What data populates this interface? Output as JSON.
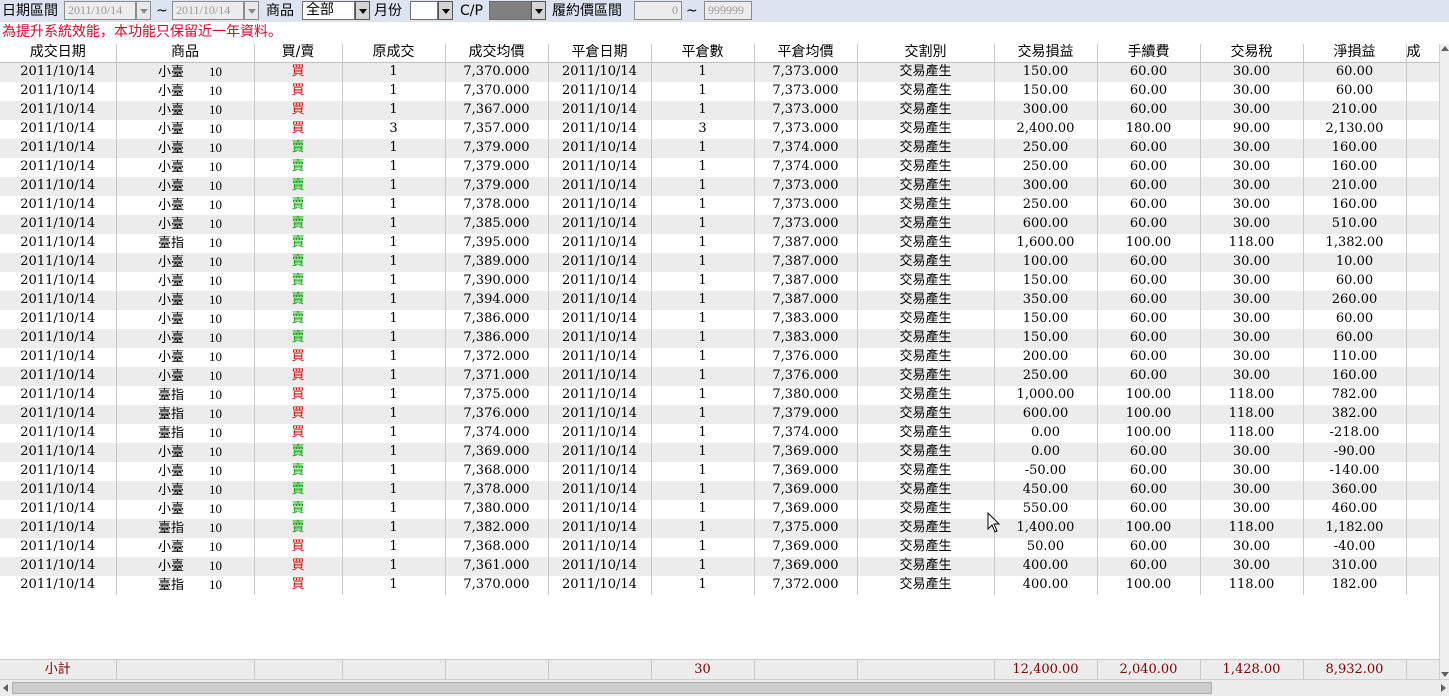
{
  "filter": {
    "date_label": "日期區間",
    "date_from": "2011/10/14",
    "tilde": "~",
    "date_to": "2011/10/14",
    "product_label": "商品",
    "product_value": "全部",
    "month_label": "月份",
    "month_value": "",
    "cp_label": "C/P",
    "cp_value": "",
    "strike_label": "履約價區間",
    "strike_from": "0",
    "strike_to": "999999"
  },
  "notice": "為提升系統效能，本功能只保留近一年資料。",
  "columns": [
    "成交日期",
    "商品",
    "買/賣",
    "原成交",
    "成交均價",
    "平倉日期",
    "平倉數",
    "平倉均價",
    "交割別",
    "交易損益",
    "手續費",
    "交易稅",
    "淨損益",
    "成"
  ],
  "rows": [
    {
      "date": "2011/10/14",
      "product": "小臺",
      "code": "10",
      "side": "買",
      "side_type": "buy",
      "qty": "1",
      "avg": "7,370.000",
      "close_date": "2011/10/14",
      "close_qty": "1",
      "close_avg": "7,373.000",
      "settle": "交易產生",
      "pl": "150.00",
      "fee": "60.00",
      "tax": "30.00",
      "net": "60.00"
    },
    {
      "date": "2011/10/14",
      "product": "小臺",
      "code": "10",
      "side": "買",
      "side_type": "buy",
      "qty": "1",
      "avg": "7,370.000",
      "close_date": "2011/10/14",
      "close_qty": "1",
      "close_avg": "7,373.000",
      "settle": "交易產生",
      "pl": "150.00",
      "fee": "60.00",
      "tax": "30.00",
      "net": "60.00"
    },
    {
      "date": "2011/10/14",
      "product": "小臺",
      "code": "10",
      "side": "買",
      "side_type": "buy",
      "qty": "1",
      "avg": "7,367.000",
      "close_date": "2011/10/14",
      "close_qty": "1",
      "close_avg": "7,373.000",
      "settle": "交易產生",
      "pl": "300.00",
      "fee": "60.00",
      "tax": "30.00",
      "net": "210.00"
    },
    {
      "date": "2011/10/14",
      "product": "小臺",
      "code": "10",
      "side": "買",
      "side_type": "buy",
      "qty": "3",
      "avg": "7,357.000",
      "close_date": "2011/10/14",
      "close_qty": "3",
      "close_avg": "7,373.000",
      "settle": "交易產生",
      "pl": "2,400.00",
      "fee": "180.00",
      "tax": "90.00",
      "net": "2,130.00"
    },
    {
      "date": "2011/10/14",
      "product": "小臺",
      "code": "10",
      "side": "賣",
      "side_type": "sell",
      "qty": "1",
      "avg": "7,379.000",
      "close_date": "2011/10/14",
      "close_qty": "1",
      "close_avg": "7,374.000",
      "settle": "交易產生",
      "pl": "250.00",
      "fee": "60.00",
      "tax": "30.00",
      "net": "160.00"
    },
    {
      "date": "2011/10/14",
      "product": "小臺",
      "code": "10",
      "side": "賣",
      "side_type": "sell",
      "qty": "1",
      "avg": "7,379.000",
      "close_date": "2011/10/14",
      "close_qty": "1",
      "close_avg": "7,374.000",
      "settle": "交易產生",
      "pl": "250.00",
      "fee": "60.00",
      "tax": "30.00",
      "net": "160.00"
    },
    {
      "date": "2011/10/14",
      "product": "小臺",
      "code": "10",
      "side": "賣",
      "side_type": "sell",
      "qty": "1",
      "avg": "7,379.000",
      "close_date": "2011/10/14",
      "close_qty": "1",
      "close_avg": "7,373.000",
      "settle": "交易產生",
      "pl": "300.00",
      "fee": "60.00",
      "tax": "30.00",
      "net": "210.00"
    },
    {
      "date": "2011/10/14",
      "product": "小臺",
      "code": "10",
      "side": "賣",
      "side_type": "sell",
      "qty": "1",
      "avg": "7,378.000",
      "close_date": "2011/10/14",
      "close_qty": "1",
      "close_avg": "7,373.000",
      "settle": "交易產生",
      "pl": "250.00",
      "fee": "60.00",
      "tax": "30.00",
      "net": "160.00"
    },
    {
      "date": "2011/10/14",
      "product": "小臺",
      "code": "10",
      "side": "賣",
      "side_type": "sell",
      "qty": "1",
      "avg": "7,385.000",
      "close_date": "2011/10/14",
      "close_qty": "1",
      "close_avg": "7,373.000",
      "settle": "交易產生",
      "pl": "600.00",
      "fee": "60.00",
      "tax": "30.00",
      "net": "510.00"
    },
    {
      "date": "2011/10/14",
      "product": "臺指",
      "code": "10",
      "side": "賣",
      "side_type": "sell",
      "qty": "1",
      "avg": "7,395.000",
      "close_date": "2011/10/14",
      "close_qty": "1",
      "close_avg": "7,387.000",
      "settle": "交易產生",
      "pl": "1,600.00",
      "fee": "100.00",
      "tax": "118.00",
      "net": "1,382.00"
    },
    {
      "date": "2011/10/14",
      "product": "小臺",
      "code": "10",
      "side": "賣",
      "side_type": "sell",
      "qty": "1",
      "avg": "7,389.000",
      "close_date": "2011/10/14",
      "close_qty": "1",
      "close_avg": "7,387.000",
      "settle": "交易產生",
      "pl": "100.00",
      "fee": "60.00",
      "tax": "30.00",
      "net": "10.00"
    },
    {
      "date": "2011/10/14",
      "product": "小臺",
      "code": "10",
      "side": "賣",
      "side_type": "sell",
      "qty": "1",
      "avg": "7,390.000",
      "close_date": "2011/10/14",
      "close_qty": "1",
      "close_avg": "7,387.000",
      "settle": "交易產生",
      "pl": "150.00",
      "fee": "60.00",
      "tax": "30.00",
      "net": "60.00"
    },
    {
      "date": "2011/10/14",
      "product": "小臺",
      "code": "10",
      "side": "賣",
      "side_type": "sell",
      "qty": "1",
      "avg": "7,394.000",
      "close_date": "2011/10/14",
      "close_qty": "1",
      "close_avg": "7,387.000",
      "settle": "交易產生",
      "pl": "350.00",
      "fee": "60.00",
      "tax": "30.00",
      "net": "260.00"
    },
    {
      "date": "2011/10/14",
      "product": "小臺",
      "code": "10",
      "side": "賣",
      "side_type": "sell",
      "qty": "1",
      "avg": "7,386.000",
      "close_date": "2011/10/14",
      "close_qty": "1",
      "close_avg": "7,383.000",
      "settle": "交易產生",
      "pl": "150.00",
      "fee": "60.00",
      "tax": "30.00",
      "net": "60.00"
    },
    {
      "date": "2011/10/14",
      "product": "小臺",
      "code": "10",
      "side": "賣",
      "side_type": "sell",
      "qty": "1",
      "avg": "7,386.000",
      "close_date": "2011/10/14",
      "close_qty": "1",
      "close_avg": "7,383.000",
      "settle": "交易產生",
      "pl": "150.00",
      "fee": "60.00",
      "tax": "30.00",
      "net": "60.00"
    },
    {
      "date": "2011/10/14",
      "product": "小臺",
      "code": "10",
      "side": "買",
      "side_type": "buy",
      "qty": "1",
      "avg": "7,372.000",
      "close_date": "2011/10/14",
      "close_qty": "1",
      "close_avg": "7,376.000",
      "settle": "交易產生",
      "pl": "200.00",
      "fee": "60.00",
      "tax": "30.00",
      "net": "110.00"
    },
    {
      "date": "2011/10/14",
      "product": "小臺",
      "code": "10",
      "side": "買",
      "side_type": "buy",
      "qty": "1",
      "avg": "7,371.000",
      "close_date": "2011/10/14",
      "close_qty": "1",
      "close_avg": "7,376.000",
      "settle": "交易產生",
      "pl": "250.00",
      "fee": "60.00",
      "tax": "30.00",
      "net": "160.00"
    },
    {
      "date": "2011/10/14",
      "product": "臺指",
      "code": "10",
      "side": "買",
      "side_type": "buy",
      "qty": "1",
      "avg": "7,375.000",
      "close_date": "2011/10/14",
      "close_qty": "1",
      "close_avg": "7,380.000",
      "settle": "交易產生",
      "pl": "1,000.00",
      "fee": "100.00",
      "tax": "118.00",
      "net": "782.00"
    },
    {
      "date": "2011/10/14",
      "product": "臺指",
      "code": "10",
      "side": "買",
      "side_type": "buy",
      "qty": "1",
      "avg": "7,376.000",
      "close_date": "2011/10/14",
      "close_qty": "1",
      "close_avg": "7,379.000",
      "settle": "交易產生",
      "pl": "600.00",
      "fee": "100.00",
      "tax": "118.00",
      "net": "382.00"
    },
    {
      "date": "2011/10/14",
      "product": "臺指",
      "code": "10",
      "side": "買",
      "side_type": "buy",
      "qty": "1",
      "avg": "7,374.000",
      "close_date": "2011/10/14",
      "close_qty": "1",
      "close_avg": "7,374.000",
      "settle": "交易產生",
      "pl": "0.00",
      "fee": "100.00",
      "tax": "118.00",
      "net": "-218.00"
    },
    {
      "date": "2011/10/14",
      "product": "小臺",
      "code": "10",
      "side": "賣",
      "side_type": "sell",
      "qty": "1",
      "avg": "7,369.000",
      "close_date": "2011/10/14",
      "close_qty": "1",
      "close_avg": "7,369.000",
      "settle": "交易產生",
      "pl": "0.00",
      "fee": "60.00",
      "tax": "30.00",
      "net": "-90.00"
    },
    {
      "date": "2011/10/14",
      "product": "小臺",
      "code": "10",
      "side": "賣",
      "side_type": "sell",
      "qty": "1",
      "avg": "7,368.000",
      "close_date": "2011/10/14",
      "close_qty": "1",
      "close_avg": "7,369.000",
      "settle": "交易產生",
      "pl": "-50.00",
      "fee": "60.00",
      "tax": "30.00",
      "net": "-140.00"
    },
    {
      "date": "2011/10/14",
      "product": "小臺",
      "code": "10",
      "side": "賣",
      "side_type": "sell",
      "qty": "1",
      "avg": "7,378.000",
      "close_date": "2011/10/14",
      "close_qty": "1",
      "close_avg": "7,369.000",
      "settle": "交易產生",
      "pl": "450.00",
      "fee": "60.00",
      "tax": "30.00",
      "net": "360.00"
    },
    {
      "date": "2011/10/14",
      "product": "小臺",
      "code": "10",
      "side": "賣",
      "side_type": "sell",
      "qty": "1",
      "avg": "7,380.000",
      "close_date": "2011/10/14",
      "close_qty": "1",
      "close_avg": "7,369.000",
      "settle": "交易產生",
      "pl": "550.00",
      "fee": "60.00",
      "tax": "30.00",
      "net": "460.00"
    },
    {
      "date": "2011/10/14",
      "product": "臺指",
      "code": "10",
      "side": "賣",
      "side_type": "sell",
      "qty": "1",
      "avg": "7,382.000",
      "close_date": "2011/10/14",
      "close_qty": "1",
      "close_avg": "7,375.000",
      "settle": "交易產生",
      "pl": "1,400.00",
      "fee": "100.00",
      "tax": "118.00",
      "net": "1,182.00"
    },
    {
      "date": "2011/10/14",
      "product": "小臺",
      "code": "10",
      "side": "買",
      "side_type": "buy",
      "qty": "1",
      "avg": "7,368.000",
      "close_date": "2011/10/14",
      "close_qty": "1",
      "close_avg": "7,369.000",
      "settle": "交易產生",
      "pl": "50.00",
      "fee": "60.00",
      "tax": "30.00",
      "net": "-40.00"
    },
    {
      "date": "2011/10/14",
      "product": "小臺",
      "code": "10",
      "side": "買",
      "side_type": "buy",
      "qty": "1",
      "avg": "7,361.000",
      "close_date": "2011/10/14",
      "close_qty": "1",
      "close_avg": "7,369.000",
      "settle": "交易產生",
      "pl": "400.00",
      "fee": "60.00",
      "tax": "30.00",
      "net": "310.00"
    },
    {
      "date": "2011/10/14",
      "product": "臺指",
      "code": "10",
      "side": "買",
      "side_type": "buy",
      "qty": "1",
      "avg": "7,370.000",
      "close_date": "2011/10/14",
      "close_qty": "1",
      "close_avg": "7,372.000",
      "settle": "交易產生",
      "pl": "400.00",
      "fee": "100.00",
      "tax": "118.00",
      "net": "182.00"
    }
  ],
  "subtotal": {
    "label": "小計",
    "close_qty": "30",
    "pl": "12,400.00",
    "fee": "2,040.00",
    "tax": "1,428.00",
    "net": "8,932.00"
  },
  "colors": {
    "buy": "#e00000",
    "sell": "#00a000",
    "notice": "#e4002b",
    "toolbar_bg": "#dde3f0",
    "subtotal_text": "#800000"
  }
}
